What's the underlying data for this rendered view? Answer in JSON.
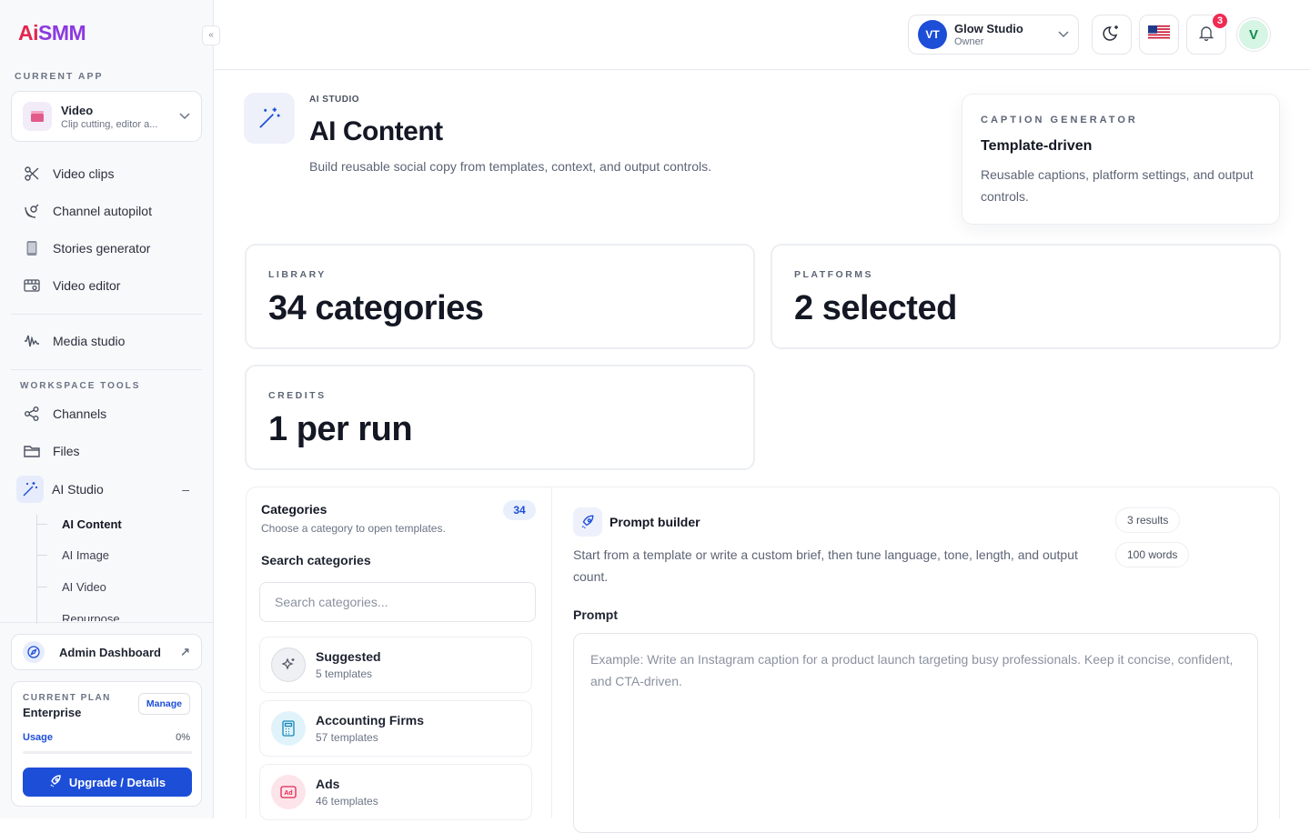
{
  "sidebar": {
    "logo_ai": "Ai",
    "logo_smm": "SMM",
    "collapse": "«",
    "current_app_label": "CURRENT APP",
    "app": {
      "name": "Video",
      "sub": "Clip cutting, editor a..."
    },
    "nav": [
      {
        "label": "Video clips",
        "icon": "scissors-icon"
      },
      {
        "label": "Channel autopilot",
        "icon": "satellite-icon"
      },
      {
        "label": "Stories generator",
        "icon": "phone-icon"
      },
      {
        "label": "Video editor",
        "icon": "film-icon"
      },
      {
        "label": "Media studio",
        "icon": "waveform-icon"
      }
    ],
    "workspace_label": "WORKSPACE TOOLS",
    "tools": [
      {
        "label": "Channels",
        "icon": "share-nodes-icon"
      },
      {
        "label": "Files",
        "icon": "folder-icon"
      },
      {
        "label": "AI Studio",
        "icon": "magic-wand-icon",
        "toggle": "–"
      }
    ],
    "sub_items": [
      "AI Content",
      "AI Image",
      "AI Video",
      "Repurpose"
    ],
    "admin": {
      "label": "Admin Dashboard",
      "arrow": "↗"
    },
    "plan": {
      "label": "CURRENT PLAN",
      "name": "Enterprise",
      "manage": "Manage",
      "usage_label": "Usage",
      "usage_value": "0%",
      "usage_fraction": 0,
      "upgrade": "Upgrade / Details"
    }
  },
  "header": {
    "workspace": {
      "initials": "VT",
      "name": "Glow Studio",
      "role": "Owner"
    },
    "notifications_count": "3",
    "user_initial": "V"
  },
  "hero": {
    "eyebrow": "AI STUDIO",
    "title": "AI Content",
    "subtitle": "Build reusable social copy from templates, context, and output controls."
  },
  "caption_card": {
    "label": "CAPTION GENERATOR",
    "title": "Template-driven",
    "desc": "Reusable captions, platform settings, and output controls."
  },
  "stats": [
    {
      "label": "LIBRARY",
      "value": "34 categories"
    },
    {
      "label": "PLATFORMS",
      "value": "2 selected"
    },
    {
      "label": "CREDITS",
      "value": "1 per run"
    }
  ],
  "categories": {
    "title": "Categories",
    "subtitle": "Choose a category to open templates.",
    "count": "34",
    "search_label": "Search categories",
    "search_placeholder": "Search categories...",
    "items": [
      {
        "name": "Suggested",
        "count": "5 templates",
        "icon": "sparkle-star-icon"
      },
      {
        "name": "Accounting Firms",
        "count": "57 templates",
        "icon": "calculator-icon"
      },
      {
        "name": "Ads",
        "count": "46 templates",
        "icon": "ad-icon"
      }
    ]
  },
  "prompt_builder": {
    "title": "Prompt builder",
    "desc": "Start from a template or write a custom brief, then tune language, tone, length, and output count.",
    "results": "3 results",
    "words": "100 words",
    "prompt_label": "Prompt",
    "placeholder": "Example: Write an Instagram caption for a product launch targeting busy professionals. Keep it concise, confident, and CTA-driven."
  },
  "colors": {
    "accent": "#1d4ed8",
    "badge": "#ef2b54",
    "logo_red": "#e2264d",
    "logo_purple": "#7c3aed"
  }
}
